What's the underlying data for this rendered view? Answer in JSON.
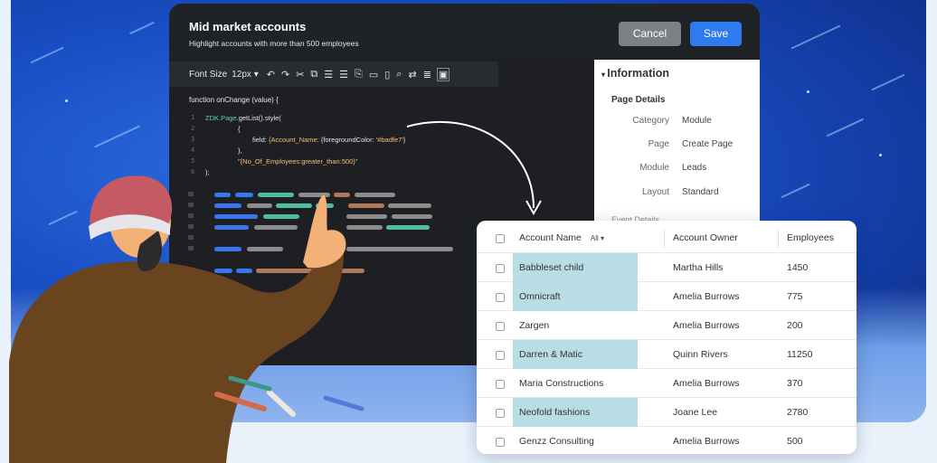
{
  "editor": {
    "title": "Mid market accounts",
    "subtitle": "Highlight accounts with more than 500 employees",
    "cancel_label": "Cancel",
    "save_label": "Save"
  },
  "toolbar": {
    "font_size_label": "Font Size",
    "font_size_value": "12px",
    "icons": [
      "undo-icon",
      "redo-icon",
      "cut-icon",
      "copy-icon",
      "indent-icon",
      "outdent-icon",
      "paste-icon",
      "comment-icon",
      "delete-icon",
      "search-icon",
      "wrap-icon",
      "format-icon",
      "terminal-icon"
    ]
  },
  "code": {
    "function_line": "function onChange (value) {",
    "line_numbers": [
      "1",
      "2",
      "3",
      "4",
      "5",
      "6"
    ],
    "line1_a": "ZDK.Page",
    "line1_b": ".getList().style(",
    "line2": "{",
    "line3_a": "field: ",
    "line3_b": "{Account_Name",
    "line3_c": ": {foregroundColor: ",
    "line3_d": "'#badfe7'",
    "line3_e": "}",
    "line4": "},",
    "line5": "\"{No_Of_Employees:greater_than:500}\"",
    "line6": ");"
  },
  "info": {
    "heading": "Information",
    "section": "Page Details",
    "rows": [
      {
        "key": "Category",
        "value": "Module"
      },
      {
        "key": "Page",
        "value": "Create Page"
      },
      {
        "key": "Module",
        "value": "Leads"
      },
      {
        "key": "Layout",
        "value": "Standard"
      }
    ],
    "cut_off_text": "Event Details"
  },
  "table": {
    "headers": {
      "name": "Account Name",
      "filter": "All",
      "owner": "Account Owner",
      "employees": "Employees"
    },
    "rows": [
      {
        "name": "Babbleset child",
        "owner": "Martha Hills",
        "employees": "1450",
        "highlighted": true
      },
      {
        "name": "Omnicraft",
        "owner": "Amelia Burrows",
        "employees": "775",
        "highlighted": true
      },
      {
        "name": "Zargen",
        "owner": "Amelia Burrows",
        "employees": "200",
        "highlighted": false
      },
      {
        "name": "Darren & Matic",
        "owner": "Quinn Rivers",
        "employees": "11250",
        "highlighted": true
      },
      {
        "name": "Maria Constructions",
        "owner": "Amelia Burrows",
        "employees": "370",
        "highlighted": false
      },
      {
        "name": "Neofold fashions",
        "owner": "Joane Lee",
        "employees": "2780",
        "highlighted": true
      },
      {
        "name": "Genzz Consulting",
        "owner": "Amelia Burrows",
        "employees": "500",
        "highlighted": false
      }
    ]
  },
  "colors": {
    "highlight": "#b9dde5",
    "save": "#2e7bf0",
    "cancel": "#7d8186",
    "editor_bg": "#1d1f22",
    "background": "#1a4fc6"
  }
}
